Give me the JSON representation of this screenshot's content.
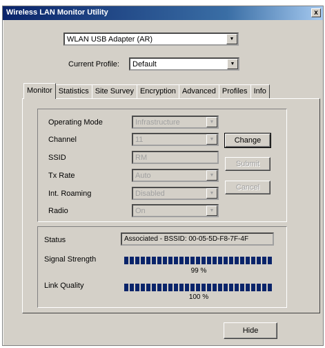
{
  "window": {
    "title": "Wireless LAN Monitor Utility",
    "close_glyph": "x"
  },
  "adapter": {
    "selected": "WLAN USB Adapter (AR)"
  },
  "profile": {
    "label": "Current Profile:",
    "selected": "Default"
  },
  "tabs": [
    "Monitor",
    "Statistics",
    "Site Survey",
    "Encryption",
    "Advanced",
    "Profiles",
    "Info"
  ],
  "active_tab": "Monitor",
  "settings": {
    "operating_mode": {
      "label": "Operating Mode",
      "value": "Infrastructure"
    },
    "channel": {
      "label": "Channel",
      "value": "11"
    },
    "ssid": {
      "label": "SSID",
      "value": "RM"
    },
    "tx_rate": {
      "label": "Tx Rate",
      "value": "Auto"
    },
    "int_roaming": {
      "label": "Int. Roaming",
      "value": "Disabled"
    },
    "radio": {
      "label": "Radio",
      "value": "On"
    }
  },
  "buttons": {
    "change": "Change",
    "submit": "Submit",
    "cancel": "Cancel",
    "hide": "Hide"
  },
  "status": {
    "label": "Status",
    "value": "Associated - BSSID: 00-05-5D-F8-7F-4F",
    "signal_label": "Signal Strength",
    "signal_percent": 99,
    "signal_text": "99 %",
    "link_label": "Link Quality",
    "link_percent": 100,
    "link_text": "100 %"
  },
  "colors": {
    "titlebar": "#0a246a",
    "face": "#d4d0c8",
    "meter": "#0a246a"
  }
}
